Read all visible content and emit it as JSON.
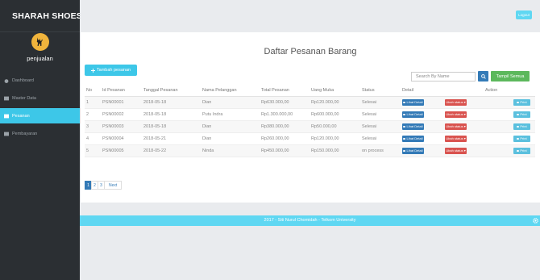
{
  "brand": {
    "title": "SHARAH SHOES"
  },
  "profile": {
    "name": "penjualan"
  },
  "sidebar": {
    "items": [
      {
        "label": "Dashboard"
      },
      {
        "label": "Master Data"
      },
      {
        "label": "Pesanan"
      },
      {
        "label": "Pembayaran"
      }
    ]
  },
  "topbar": {
    "logout_label": "Logout"
  },
  "page": {
    "title": "Daftar Pesanan Barang"
  },
  "toolbar": {
    "add_label": "Tambah pesanan",
    "search_placeholder": "Search By Name",
    "show_all_label": "Tampil Semua"
  },
  "table": {
    "headers": [
      "No",
      "Id Pesanan",
      "Tanggal Pesanan",
      "Nama Pelanggan",
      "Total Pesanan",
      "Uang Muka",
      "Status",
      "Detail",
      "",
      "Action"
    ],
    "detail_label": "Lihat Detail",
    "status_label": "Ubah status ▾",
    "print_label": "Print",
    "rows": [
      {
        "no": "1",
        "id": "PSN00001",
        "date": "2018-05-18",
        "name": "Dian",
        "total": "Rp630.000,00",
        "dp": "Rp120.000,00",
        "status": "Selesai"
      },
      {
        "no": "2",
        "id": "PSN00002",
        "date": "2018-05-18",
        "name": "Putu Indra",
        "total": "Rp1.300.000,00",
        "dp": "Rp600.000,00",
        "status": "Selesai"
      },
      {
        "no": "3",
        "id": "PSN00003",
        "date": "2018-05-18",
        "name": "Dian",
        "total": "Rp380.000,00",
        "dp": "Rp50.000,00",
        "status": "Selesai"
      },
      {
        "no": "4",
        "id": "PSN00004",
        "date": "2018-05-21",
        "name": "Dian",
        "total": "Rp260.000,00",
        "dp": "Rp120.000,00",
        "status": "Selesai"
      },
      {
        "no": "5",
        "id": "PSN00005",
        "date": "2018-05-22",
        "name": "Ninda",
        "total": "Rp450.000,00",
        "dp": "Rp150.000,00",
        "status": "on process"
      }
    ]
  },
  "pagination": {
    "pages": [
      "1",
      "2",
      "3"
    ],
    "next_label": "Next",
    "current": "1"
  },
  "footer": {
    "text": "2017 - Siti Nurul Chomidah - Telkom University"
  },
  "colors": {
    "accent": "#3dc7e8",
    "primary": "#337ab7",
    "success": "#5cb85c",
    "danger": "#d9534f",
    "sidebar": "#2b2f33"
  }
}
